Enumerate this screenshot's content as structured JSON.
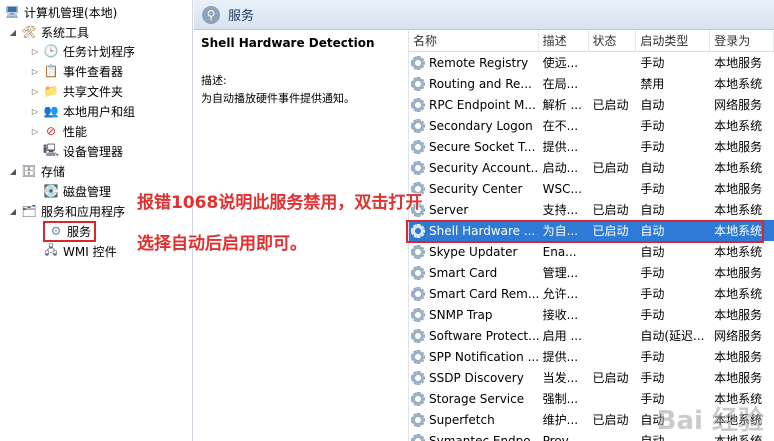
{
  "tree": {
    "root": "计算机管理(本地)",
    "system_tools": "系统工具",
    "task_scheduler": "任务计划程序",
    "event_viewer": "事件查看器",
    "shared_folders": "共享文件夹",
    "local_users": "本地用户和组",
    "performance": "性能",
    "device_manager": "设备管理器",
    "storage": "存储",
    "disk_management": "磁盘管理",
    "services_apps": "服务和应用程序",
    "services": "服务",
    "wmi": "WMI 控件"
  },
  "header": {
    "title": "服务"
  },
  "description": {
    "service_name": "Shell Hardware Detection",
    "label": "描述:",
    "text": "为自动播放硬件事件提供通知。"
  },
  "columns": [
    "名称",
    "描述",
    "状态",
    "启动类型",
    "登录为"
  ],
  "rows": [
    {
      "name": "Remote Registry",
      "desc": "使远...",
      "status": "",
      "startup": "手动",
      "logon": "本地服务"
    },
    {
      "name": "Routing and Re...",
      "desc": "在局...",
      "status": "",
      "startup": "禁用",
      "logon": "本地系统"
    },
    {
      "name": "RPC Endpoint M...",
      "desc": "解析 ...",
      "status": "已启动",
      "startup": "自动",
      "logon": "网络服务"
    },
    {
      "name": "Secondary Logon",
      "desc": "在不...",
      "status": "",
      "startup": "手动",
      "logon": "本地系统"
    },
    {
      "name": "Secure Socket T...",
      "desc": "提供...",
      "status": "",
      "startup": "手动",
      "logon": "本地服务"
    },
    {
      "name": "Security Account...",
      "desc": "启动...",
      "status": "已启动",
      "startup": "自动",
      "logon": "本地系统"
    },
    {
      "name": "Security Center",
      "desc": "WSC...",
      "status": "",
      "startup": "手动",
      "logon": "本地服务"
    },
    {
      "name": "Server",
      "desc": "支持...",
      "status": "已启动",
      "startup": "自动",
      "logon": "本地系统"
    },
    {
      "name": "Shell Hardware ...",
      "desc": "为自...",
      "status": "已启动",
      "startup": "自动",
      "logon": "本地系统"
    },
    {
      "name": "Skype Updater",
      "desc": "Ena...",
      "status": "",
      "startup": "自动",
      "logon": "本地系统"
    },
    {
      "name": "Smart Card",
      "desc": "管理...",
      "status": "",
      "startup": "手动",
      "logon": "本地服务"
    },
    {
      "name": "Smart Card Rem...",
      "desc": "允许...",
      "status": "",
      "startup": "手动",
      "logon": "本地系统"
    },
    {
      "name": "SNMP Trap",
      "desc": "接收...",
      "status": "",
      "startup": "手动",
      "logon": "本地服务"
    },
    {
      "name": "Software Protect...",
      "desc": "启用 ...",
      "status": "",
      "startup": "自动(延迟...",
      "logon": "网络服务"
    },
    {
      "name": "SPP Notification ...",
      "desc": "提供...",
      "status": "",
      "startup": "手动",
      "logon": "本地服务"
    },
    {
      "name": "SSDP Discovery",
      "desc": "当发...",
      "status": "已启动",
      "startup": "手动",
      "logon": "本地服务"
    },
    {
      "name": "Storage Service",
      "desc": "强制...",
      "status": "",
      "startup": "手动",
      "logon": "本地系统"
    },
    {
      "name": "Superfetch",
      "desc": "维护...",
      "status": "已启动",
      "startup": "自动",
      "logon": "本地系统"
    },
    {
      "name": "Symantec Endpo...",
      "desc": "Prov...",
      "status": "",
      "startup": "自动",
      "logon": "本地系统"
    }
  ],
  "selected_row": 8,
  "annotation": {
    "line1": "报错1068说明此服务禁用，双击打开",
    "line2": "选择自动后启用即可。"
  },
  "watermark": "Bai 经验",
  "colors": {
    "highlight": "#2d7bd6",
    "annotation": "#e03030"
  }
}
